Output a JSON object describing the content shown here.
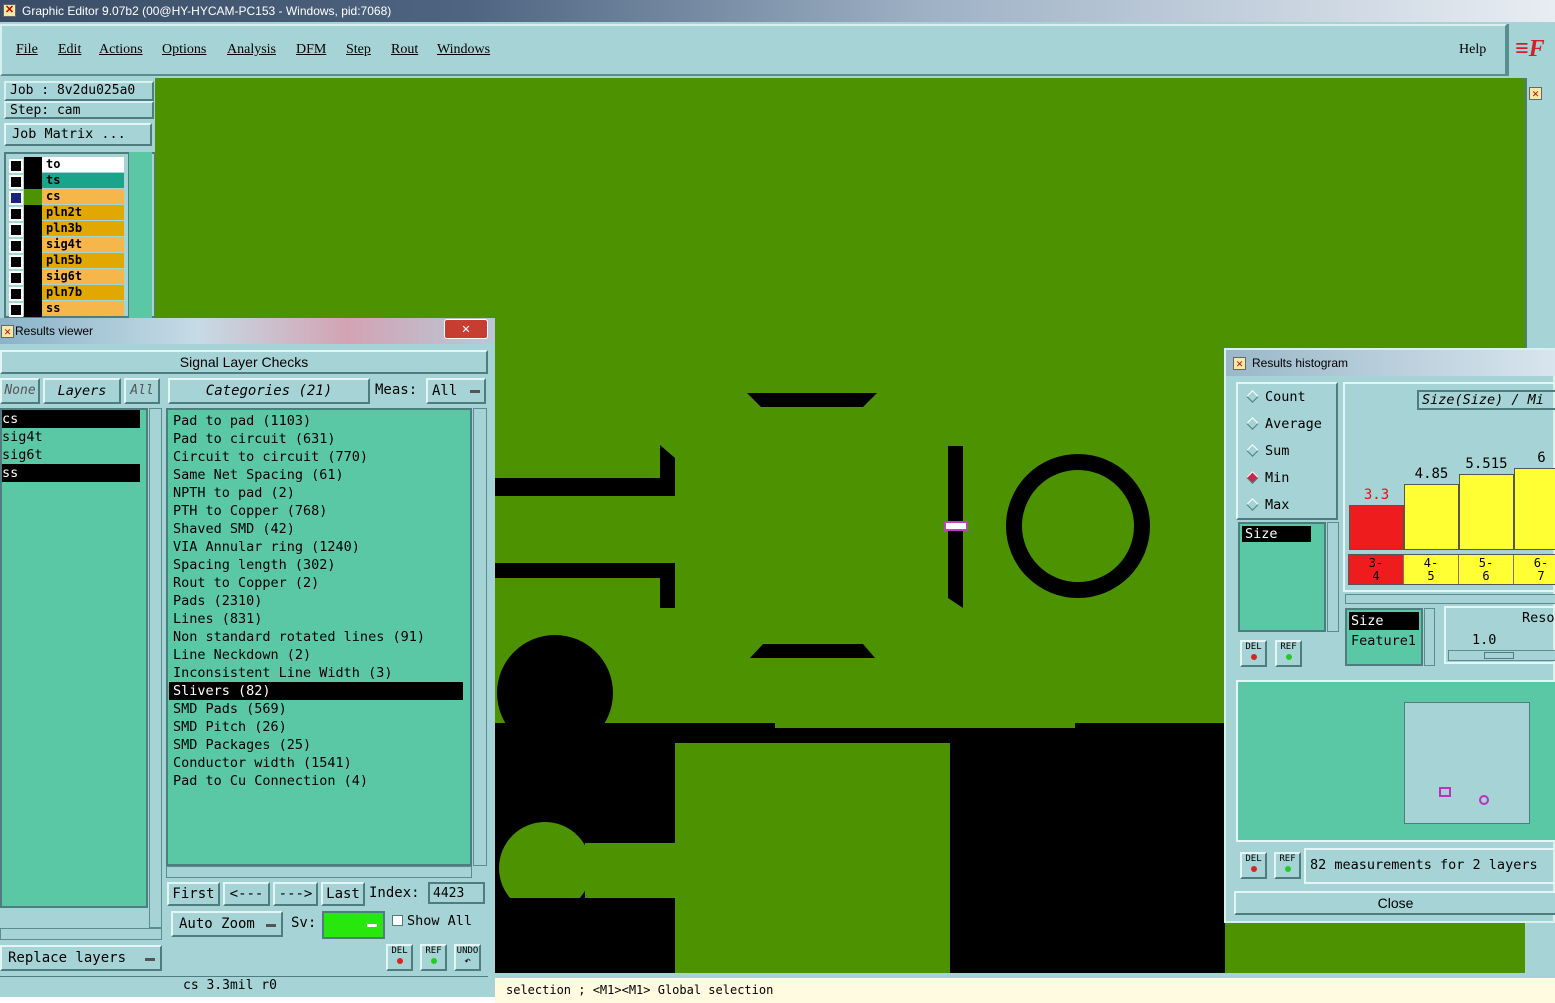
{
  "window": {
    "title": "Graphic Editor 9.07b2 (00@HY-HYCAM-PC153 - Windows, pid:7068)"
  },
  "menu": [
    "File",
    "Edit",
    "Actions",
    "Options",
    "Analysis",
    "DFM",
    "Step",
    "Rout",
    "Windows"
  ],
  "help": "Help",
  "logo": "≡F",
  "job": {
    "job_label": "Job : 8v2du025a0",
    "step_label": "Step: cam",
    "matrix_button": "Job Matrix ..."
  },
  "layers": [
    {
      "name": "to",
      "color": "#ffffff",
      "swatch": "#000000"
    },
    {
      "name": "ts",
      "color": "#1ba48c",
      "swatch": "#000000"
    },
    {
      "name": "cs",
      "color": "#f6b74a",
      "swatch": "#4d9200"
    },
    {
      "name": "pln2t",
      "color": "#e0a800",
      "swatch": "#000000"
    },
    {
      "name": "pln3b",
      "color": "#e0a800",
      "swatch": "#000000"
    },
    {
      "name": "sig4t",
      "color": "#f6b74a",
      "swatch": "#000000"
    },
    {
      "name": "pln5b",
      "color": "#e0a800",
      "swatch": "#000000"
    },
    {
      "name": "sig6t",
      "color": "#f6b74a",
      "swatch": "#000000"
    },
    {
      "name": "pln7b",
      "color": "#e0a800",
      "swatch": "#000000"
    },
    {
      "name": "ss",
      "color": "#f6b74a",
      "swatch": "#000000"
    }
  ],
  "results_viewer": {
    "title": "Results viewer",
    "header": "Signal Layer Checks",
    "none_btn": "None",
    "layers_btn": "Layers",
    "all_btn": "All",
    "categories_btn": "Categories (21)",
    "meas_label": "Meas:",
    "meas_value": "All",
    "layer_list": [
      {
        "name": "cs",
        "selected": true
      },
      {
        "name": "sig4t",
        "selected": false
      },
      {
        "name": "sig6t",
        "selected": false
      },
      {
        "name": "ss",
        "selected": true
      }
    ],
    "categories": [
      {
        "text": "Pad to pad (1103)",
        "selected": false
      },
      {
        "text": "Pad to circuit (631)",
        "selected": false
      },
      {
        "text": "Circuit to circuit (770)",
        "selected": false
      },
      {
        "text": "Same Net Spacing (61)",
        "selected": false
      },
      {
        "text": "NPTH to pad (2)",
        "selected": false
      },
      {
        "text": "PTH to Copper (768)",
        "selected": false
      },
      {
        "text": "Shaved SMD (42)",
        "selected": false
      },
      {
        "text": "VIA Annular ring (1240)",
        "selected": false
      },
      {
        "text": "Spacing length (302)",
        "selected": false
      },
      {
        "text": "Rout to Copper (2)",
        "selected": false
      },
      {
        "text": "Pads (2310)",
        "selected": false
      },
      {
        "text": "Lines (831)",
        "selected": false
      },
      {
        "text": "Non standard rotated lines (91)",
        "selected": false
      },
      {
        "text": "Line Neckdown (2)",
        "selected": false
      },
      {
        "text": "Inconsistent Line Width (3)",
        "selected": false
      },
      {
        "text": "Slivers (82)",
        "selected": true
      },
      {
        "text": "SMD Pads (569)",
        "selected": false
      },
      {
        "text": "SMD Pitch (26)",
        "selected": false
      },
      {
        "text": "SMD Packages (25)",
        "selected": false
      },
      {
        "text": "Conductor width (1541)",
        "selected": false
      },
      {
        "text": "Pad to Cu Connection (4)",
        "selected": false
      }
    ],
    "first_btn": "First",
    "prev_btn": "<---",
    "next_btn": "--->",
    "last_btn": "Last",
    "index_label": "Index:",
    "index_value": "4423",
    "auto_zoom": "Auto Zoom",
    "sv_label": "Sv:",
    "show_all": "Show All",
    "replace_layers": "Replace layers",
    "del_btn": "DEL",
    "ref_btn": "REF",
    "undo_btn": "UNDO",
    "status": "cs 3.3mil  r0",
    "bottom_text": "..."
  },
  "status_bar": {
    "text": "selection ; <M1><M1> Global selection"
  },
  "histogram": {
    "title": "Results histogram",
    "modes": [
      {
        "label": "Count",
        "selected": false
      },
      {
        "label": "Average",
        "selected": false
      },
      {
        "label": "Sum",
        "selected": false
      },
      {
        "label": "Min",
        "selected": true
      },
      {
        "label": "Max",
        "selected": false
      }
    ],
    "header": "Size(Size) / Mi",
    "list_item": "Size",
    "size_items": [
      "Size",
      "Feature1"
    ],
    "resolution_label": "Reso",
    "resolution_value": "1.0",
    "del_btn": "DEL",
    "ref_btn": "REF",
    "summary": "82 measurements for 2 layers",
    "close": "Close"
  },
  "chart_data": {
    "type": "bar",
    "categories": [
      "3-4",
      "4-5",
      "5-6",
      "6-7"
    ],
    "values": [
      3.3,
      4.85,
      5.515,
      6
    ],
    "value_labels": [
      "3.3",
      "4.85",
      "5.515",
      "6"
    ],
    "colors": [
      "#ee1c1c",
      "#ffff33",
      "#ffff33",
      "#ffff33"
    ],
    "title": "Size(Size) / Mi"
  }
}
